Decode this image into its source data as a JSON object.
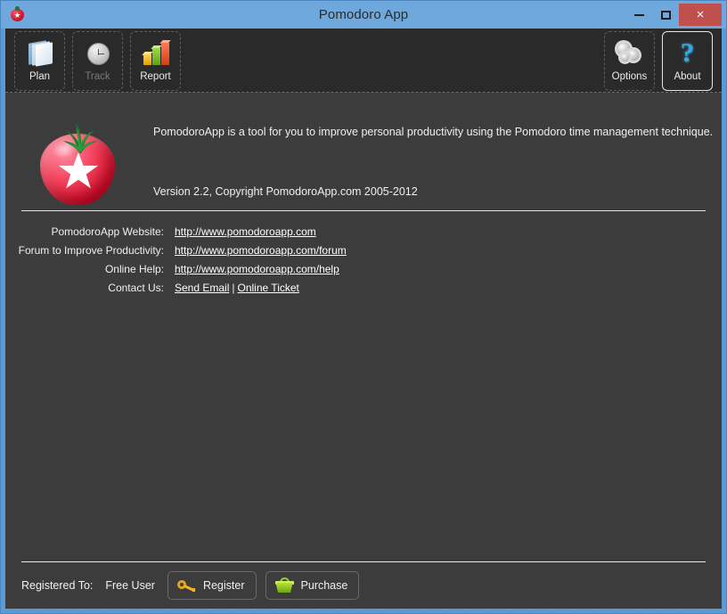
{
  "window": {
    "title": "Pomodoro App",
    "icon": "tomato-icon",
    "controls": {
      "minimize": "minimize-icon",
      "maximize": "maximize-icon",
      "close": "×"
    }
  },
  "toolbar": {
    "left_buttons": [
      {
        "label": "Plan",
        "icon": "plan-icon",
        "state": "enabled"
      },
      {
        "label": "Track",
        "icon": "clock-icon",
        "state": "disabled"
      },
      {
        "label": "Report",
        "icon": "bar-chart-icon",
        "state": "enabled"
      }
    ],
    "right_buttons": [
      {
        "label": "Options",
        "icon": "gears-icon",
        "state": "enabled"
      },
      {
        "label": "About",
        "icon": "question-mark-icon",
        "state": "active"
      }
    ]
  },
  "about": {
    "logo": "tomato-star-logo",
    "description": "PomodoroApp is a tool for you to improve personal productivity using the Pomodoro time management technique.",
    "version": "Version 2.2, Copyright PomodoroApp.com 2005-2012"
  },
  "links": [
    {
      "label": "PomodoroApp Website:",
      "items": [
        {
          "text": "http://www.pomodoroapp.com"
        }
      ]
    },
    {
      "label": "Forum to Improve Productivity:",
      "items": [
        {
          "text": "http://www.pomodoroapp.com/forum"
        }
      ]
    },
    {
      "label": "Online Help:",
      "items": [
        {
          "text": "http://www.pomodoroapp.com/help"
        }
      ]
    },
    {
      "label": "Contact Us:",
      "items": [
        {
          "text": "Send Email"
        },
        {
          "text": "Online Ticket"
        }
      ],
      "separator": "|"
    }
  ],
  "footer": {
    "registered_label": "Registered To:",
    "registered_value": "Free User",
    "register_button": "Register",
    "register_icon": "key-icon",
    "purchase_button": "Purchase",
    "purchase_icon": "basket-icon"
  },
  "colors": {
    "titlebar": "#6fa8dc",
    "frame": "#5a9bd5",
    "client_bg": "#3b3b3b",
    "toolbar_bg": "#2a2a2a",
    "close_button": "#c0504d",
    "text": "#f0f0f0",
    "tomato_red": "#d4102c",
    "leaf_green": "#1f7a2e"
  }
}
